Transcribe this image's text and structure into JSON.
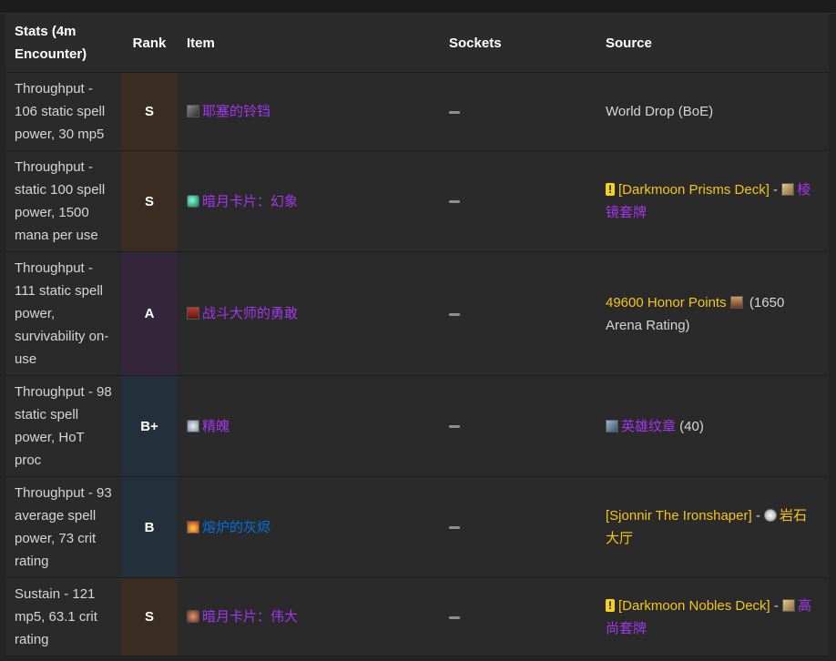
{
  "header": {
    "stats": "Stats (4m Encounter)",
    "rank": "Rank",
    "item": "Item",
    "sockets": "Sockets",
    "source": "Source"
  },
  "rows": [
    {
      "stats": "Throughput - 106 static spell power, 30 mp5",
      "rank": "S",
      "item": "耶塞的铃铛",
      "item_icon": "bell-icon",
      "source": "World Drop (BoE)"
    },
    {
      "stats": "Throughput - static 100 spell power, 1500 mana per use",
      "rank": "S",
      "item": "暗月卡片：幻象",
      "item_icon": "card-icon",
      "source_quest": "[Darkmoon Prisms Deck]",
      "source_sep": " - ",
      "source_item": "棱镜套牌"
    },
    {
      "stats": "Throughput - 111 static spell power, survivability on-use",
      "rank": "A",
      "item": "战斗大师的勇敢",
      "item_icon": "rune-icon",
      "source_honor": "49600 Honor Points",
      "source_extra": " (1650 Arena Rating)"
    },
    {
      "stats": "Throughput - 98 static spell power, HoT proc",
      "rank": "B+",
      "item": "精魄",
      "item_icon": "spirit-icon",
      "source_item": "英雄纹章",
      "source_extra": " (40)"
    },
    {
      "stats": "Throughput - 93 average spell power, 73 crit rating",
      "rank": "B",
      "item": "熔炉的灰烬",
      "item_icon": "fire-icon",
      "source_quest": "[Sjonnir The Ironshaper]",
      "source_sep": " - ",
      "source_zone": "岩石大厅"
    },
    {
      "stats": "Sustain - 121 mp5, 63.1 crit rating",
      "rank": "S",
      "item": "暗月卡片：伟大",
      "item_icon": "card-icon",
      "source_quest": "[Darkmoon Nobles Deck]",
      "source_sep": " - ",
      "source_item": "高尚套牌"
    }
  ],
  "colors": {
    "epic": "#a335ee",
    "rare": "#0070dd",
    "quest": "#f5c518",
    "rank_S_bg": "#3a2c20",
    "rank_A_bg": "#33253a",
    "rank_B_bg": "#232f3a"
  }
}
